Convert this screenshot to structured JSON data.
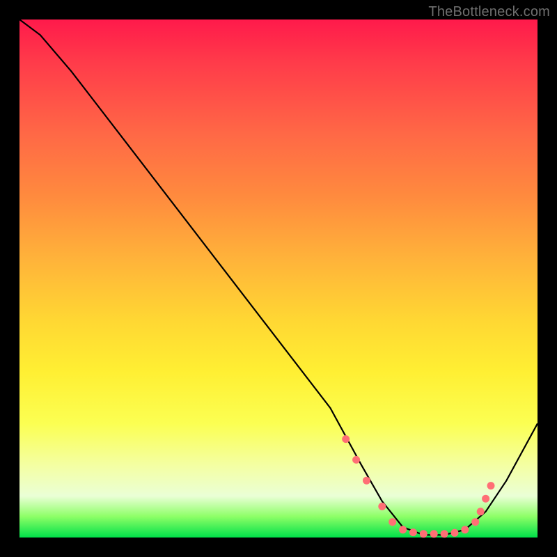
{
  "watermark": "TheBottleneck.com",
  "chart_data": {
    "type": "line",
    "title": "",
    "xlabel": "",
    "ylabel": "",
    "xlim": [
      0,
      100
    ],
    "ylim": [
      0,
      100
    ],
    "grid": false,
    "series": [
      {
        "name": "curve",
        "x": [
          0,
          4,
          10,
          20,
          30,
          40,
          50,
          60,
          66,
          70,
          74,
          78,
          82,
          86,
          90,
          94,
          100
        ],
        "y": [
          100,
          97,
          90,
          77,
          64,
          51,
          38,
          25,
          14,
          7,
          2,
          0.5,
          0.5,
          1.5,
          5,
          11,
          22
        ]
      }
    ],
    "markers": {
      "name": "dots",
      "color": "#ff6f75",
      "x": [
        63,
        65,
        67,
        70,
        72,
        74,
        76,
        78,
        80,
        82,
        84,
        86,
        88,
        89,
        90,
        91
      ],
      "y": [
        19,
        15,
        11,
        6,
        3,
        1.5,
        1.0,
        0.7,
        0.7,
        0.7,
        0.9,
        1.5,
        3.0,
        5.0,
        7.5,
        10.0
      ]
    }
  }
}
